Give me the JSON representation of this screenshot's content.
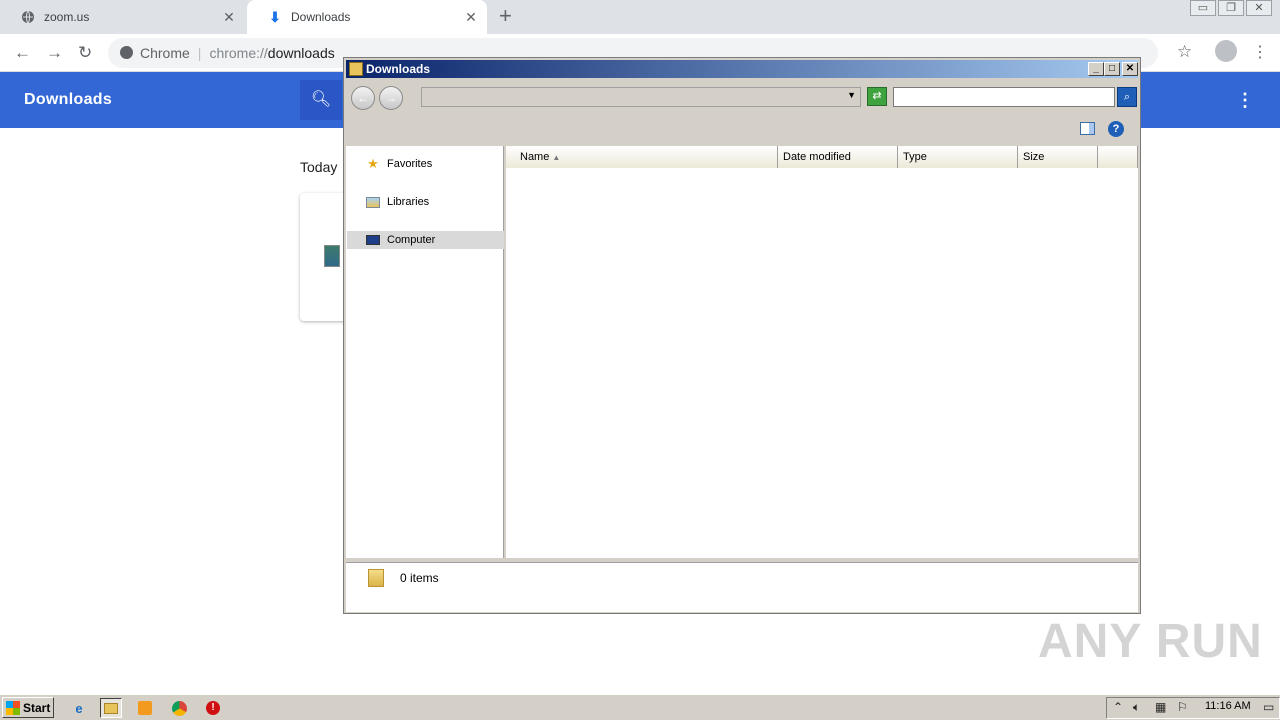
{
  "browser": {
    "tabs": [
      {
        "title": "zoom.us",
        "icon": "globe-icon",
        "active": false
      },
      {
        "title": "Downloads",
        "icon": "download-icon",
        "active": true
      }
    ],
    "new_tab_label": "+",
    "omnibox": {
      "site_label": "Chrome",
      "url_scheme": "chrome://",
      "url_path": "downloads"
    }
  },
  "downloads_page": {
    "title": "Downloads",
    "section_label": "Today"
  },
  "explorer": {
    "title": "Downloads",
    "address_value": "",
    "search_placeholder": "",
    "nav_items": [
      {
        "label": "Favorites",
        "icon": "star-icon",
        "selected": false
      },
      {
        "label": "Libraries",
        "icon": "libraries-icon",
        "selected": false
      },
      {
        "label": "Computer",
        "icon": "computer-icon",
        "selected": true
      }
    ],
    "columns": [
      {
        "label": "Name",
        "sorted": "asc"
      },
      {
        "label": "Date modified"
      },
      {
        "label": "Type"
      },
      {
        "label": "Size"
      }
    ],
    "rows": [],
    "status_text": "0 items"
  },
  "taskbar": {
    "start_label": "Start",
    "apps": [
      "internet-explorer",
      "windows-explorer",
      "media-player",
      "chrome",
      "stop-app"
    ],
    "clock": "11:16 AM"
  },
  "watermark": "ANY RUN"
}
